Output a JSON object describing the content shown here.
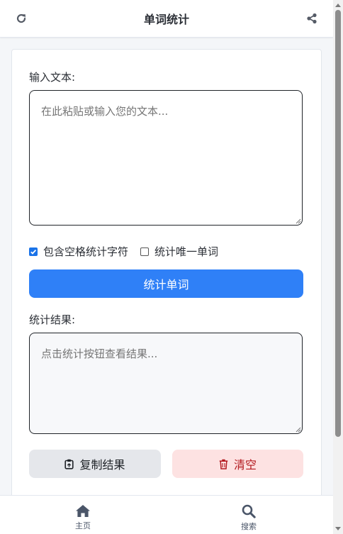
{
  "header": {
    "title": "单词统计",
    "left_icon": "refresh-icon",
    "right_icon": "share-icon"
  },
  "input_section": {
    "label": "输入文本:",
    "placeholder": "在此粘贴或输入您的文本...",
    "value": ""
  },
  "options": [
    {
      "label": "包含空格统计字符",
      "checked": true
    },
    {
      "label": "统计唯一单词",
      "checked": false
    }
  ],
  "count_button": {
    "label": "统计单词"
  },
  "result_section": {
    "label": "统计结果:",
    "placeholder": "点击统计按钮查看结果...",
    "value": ""
  },
  "actions": {
    "copy": {
      "label": "复制结果",
      "icon": "clipboard-icon"
    },
    "clear": {
      "label": "清空",
      "icon": "trash-icon"
    }
  },
  "bottom_nav": [
    {
      "label": "主页",
      "icon": "home-icon"
    },
    {
      "label": "搜索",
      "icon": "search-icon"
    }
  ],
  "colors": {
    "primary": "#2f80f7",
    "clear_bg": "#fde2e2",
    "clear_text": "#b3191f",
    "copy_bg": "#e5e7eb"
  }
}
